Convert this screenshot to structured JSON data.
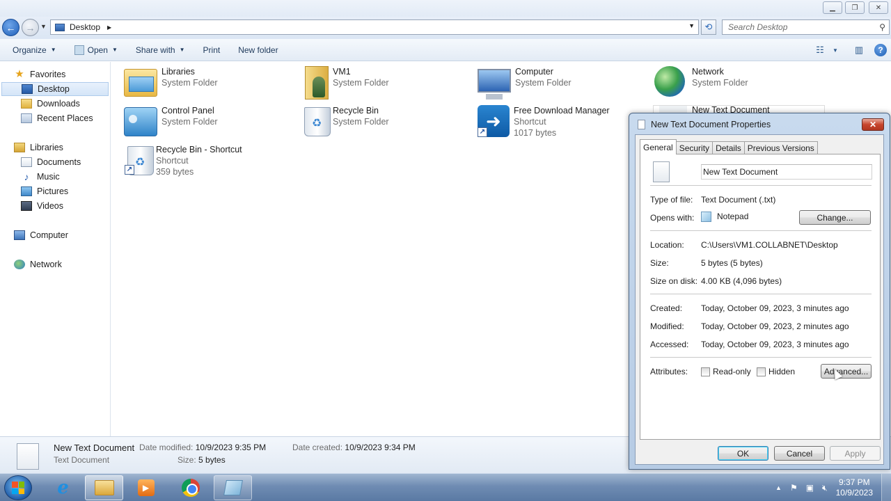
{
  "window": {
    "address": "Desktop",
    "search_placeholder": "Search Desktop"
  },
  "toolbar": {
    "organize": "Organize",
    "open": "Open",
    "share_with": "Share with",
    "print": "Print",
    "new_folder": "New folder"
  },
  "nav": {
    "favorites": "Favorites",
    "desktop": "Desktop",
    "downloads": "Downloads",
    "recent_places": "Recent Places",
    "libraries": "Libraries",
    "documents": "Documents",
    "music": "Music",
    "pictures": "Pictures",
    "videos": "Videos",
    "computer": "Computer",
    "network": "Network"
  },
  "items": [
    {
      "name": "Libraries",
      "type": "System Folder",
      "icon": "libraries-icon"
    },
    {
      "name": "VM1",
      "type": "System Folder",
      "icon": "user-folder-icon"
    },
    {
      "name": "Computer",
      "type": "System Folder",
      "icon": "computer-icon"
    },
    {
      "name": "Network",
      "type": "System Folder",
      "icon": "network-icon"
    },
    {
      "name": "Control Panel",
      "type": "System Folder",
      "icon": "control-panel-icon"
    },
    {
      "name": "Recycle Bin",
      "type": "System Folder",
      "icon": "recycle-bin-icon"
    },
    {
      "name": "Free Download Manager",
      "type": "Shortcut",
      "size": "1017 bytes",
      "icon": "fdm-icon"
    },
    {
      "name": "New Text Document",
      "type": "",
      "icon": "text-file-icon"
    },
    {
      "name": "Recycle Bin - Shortcut",
      "type": "Shortcut",
      "size": "359 bytes",
      "icon": "recycle-bin-icon"
    }
  ],
  "details": {
    "name": "New Text Document",
    "type": "Text Document",
    "date_modified_label": "Date modified:",
    "date_modified": "10/9/2023 9:35 PM",
    "date_created_label": "Date created:",
    "date_created": "10/9/2023 9:34 PM",
    "size_label": "Size:",
    "size": "5 bytes"
  },
  "taskbar": {
    "time": "9:37 PM",
    "date": "10/9/2023"
  },
  "dialog": {
    "title": "New Text Document Properties",
    "tabs": [
      "General",
      "Security",
      "Details",
      "Previous Versions"
    ],
    "file_name": "New Text Document",
    "type_of_file_label": "Type of file:",
    "type_of_file": "Text Document (.txt)",
    "opens_with_label": "Opens with:",
    "opens_with": "Notepad",
    "change_button": "Change...",
    "location_label": "Location:",
    "location": "C:\\Users\\VM1.COLLABNET\\Desktop",
    "size_label": "Size:",
    "size": "5 bytes (5 bytes)",
    "size_on_disk_label": "Size on disk:",
    "size_on_disk": "4.00 KB (4,096 bytes)",
    "created_label": "Created:",
    "created": "Today, October 09, 2023, 3 minutes ago",
    "modified_label": "Modified:",
    "modified": "Today, October 09, 2023, 2 minutes ago",
    "accessed_label": "Accessed:",
    "accessed": "Today, October 09, 2023, 3 minutes ago",
    "attributes_label": "Attributes:",
    "readonly_label": "Read-only",
    "readonly_checked": false,
    "hidden_label": "Hidden",
    "hidden_checked": false,
    "advanced_button": "Advanced...",
    "ok_button": "OK",
    "cancel_button": "Cancel",
    "apply_button": "Apply"
  }
}
